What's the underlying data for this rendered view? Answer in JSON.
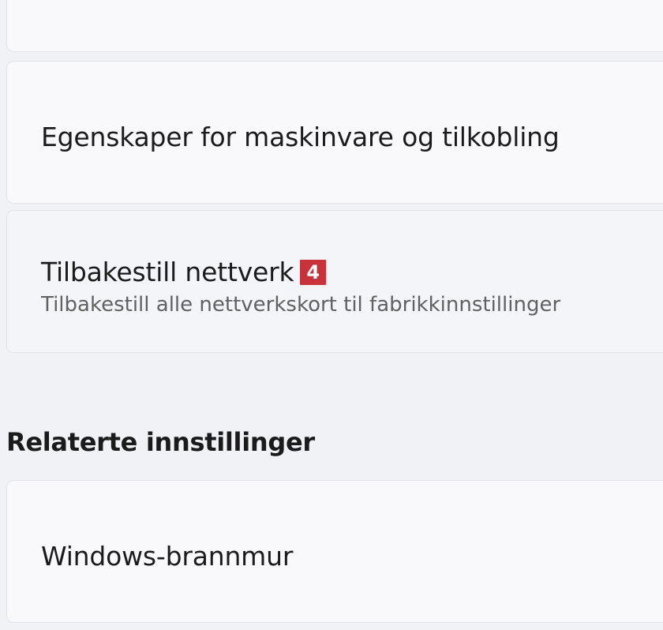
{
  "settings": {
    "items": [
      {
        "title": "Egenskaper for maskinvare og tilkobling"
      },
      {
        "title": "Tilbakestill nettverk",
        "badge": "4",
        "subtitle": "Tilbakestill alle nettverkskort til fabrikkinnstillinger"
      }
    ]
  },
  "related": {
    "heading": "Relaterte innstillinger",
    "items": [
      {
        "title": "Windows-brannmur"
      }
    ]
  },
  "colors": {
    "background": "#f1f2f6",
    "card": "#f9f9fb",
    "badge": "#c8323b"
  }
}
